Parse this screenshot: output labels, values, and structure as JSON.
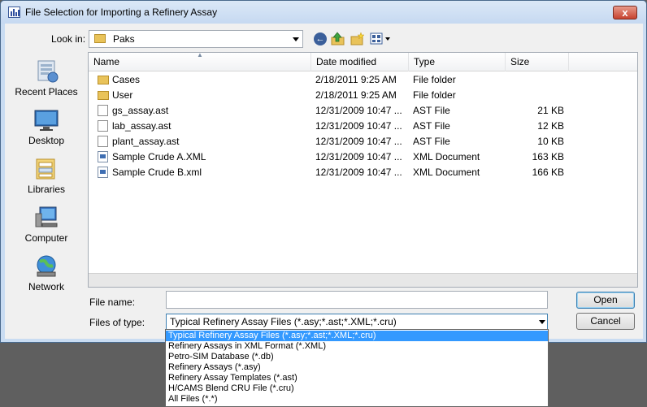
{
  "window": {
    "title": "File Selection for Importing a Refinery Assay",
    "close_glyph": "x"
  },
  "toolbar": {
    "lookin_label": "Look in:",
    "lookin_value": "Paks",
    "icons": [
      "back-icon",
      "up-folder-icon",
      "new-folder-icon",
      "views-menu-icon"
    ]
  },
  "places": [
    {
      "label": "Recent Places",
      "icon": "recent-places-icon"
    },
    {
      "label": "Desktop",
      "icon": "desktop-icon"
    },
    {
      "label": "Libraries",
      "icon": "libraries-icon"
    },
    {
      "label": "Computer",
      "icon": "computer-icon"
    },
    {
      "label": "Network",
      "icon": "network-icon"
    }
  ],
  "filelist": {
    "columns": [
      "Name",
      "Date modified",
      "Type",
      "Size"
    ],
    "rows": [
      {
        "name": "Cases",
        "date": "2/18/2011 9:25 AM",
        "type": "File folder",
        "size": "",
        "icon": "folder"
      },
      {
        "name": "User",
        "date": "2/18/2011 9:25 AM",
        "type": "File folder",
        "size": "",
        "icon": "folder"
      },
      {
        "name": "gs_assay.ast",
        "date": "12/31/2009 10:47 ...",
        "type": "AST File",
        "size": "21 KB",
        "icon": "doc"
      },
      {
        "name": "lab_assay.ast",
        "date": "12/31/2009 10:47 ...",
        "type": "AST File",
        "size": "12 KB",
        "icon": "doc"
      },
      {
        "name": "plant_assay.ast",
        "date": "12/31/2009 10:47 ...",
        "type": "AST File",
        "size": "10 KB",
        "icon": "doc"
      },
      {
        "name": "Sample Crude A.XML",
        "date": "12/31/2009 10:47 ...",
        "type": "XML Document",
        "size": "163 KB",
        "icon": "xml"
      },
      {
        "name": "Sample Crude B.xml",
        "date": "12/31/2009 10:47 ...",
        "type": "XML Document",
        "size": "166 KB",
        "icon": "xml"
      }
    ]
  },
  "form": {
    "filename_label": "File name:",
    "filename_value": "",
    "filetype_label": "Files of type:",
    "filetype_value": "Typical Refinery Assay Files (*.asy;*.ast;*.XML;*.cru)",
    "open_label": "Open",
    "cancel_label": "Cancel"
  },
  "filetype_options": [
    "Typical Refinery Assay Files (*.asy;*.ast;*.XML;*.cru)",
    "Refinery Assays in XML Format (*.XML)",
    "Petro-SIM Database (*.db)",
    "Refinery Assays (*.asy)",
    "Refinery Assay Templates (*.ast)",
    "H/CAMS Blend CRU File (*.cru)",
    "All Files (*.*)"
  ],
  "filetype_selected_index": 0
}
